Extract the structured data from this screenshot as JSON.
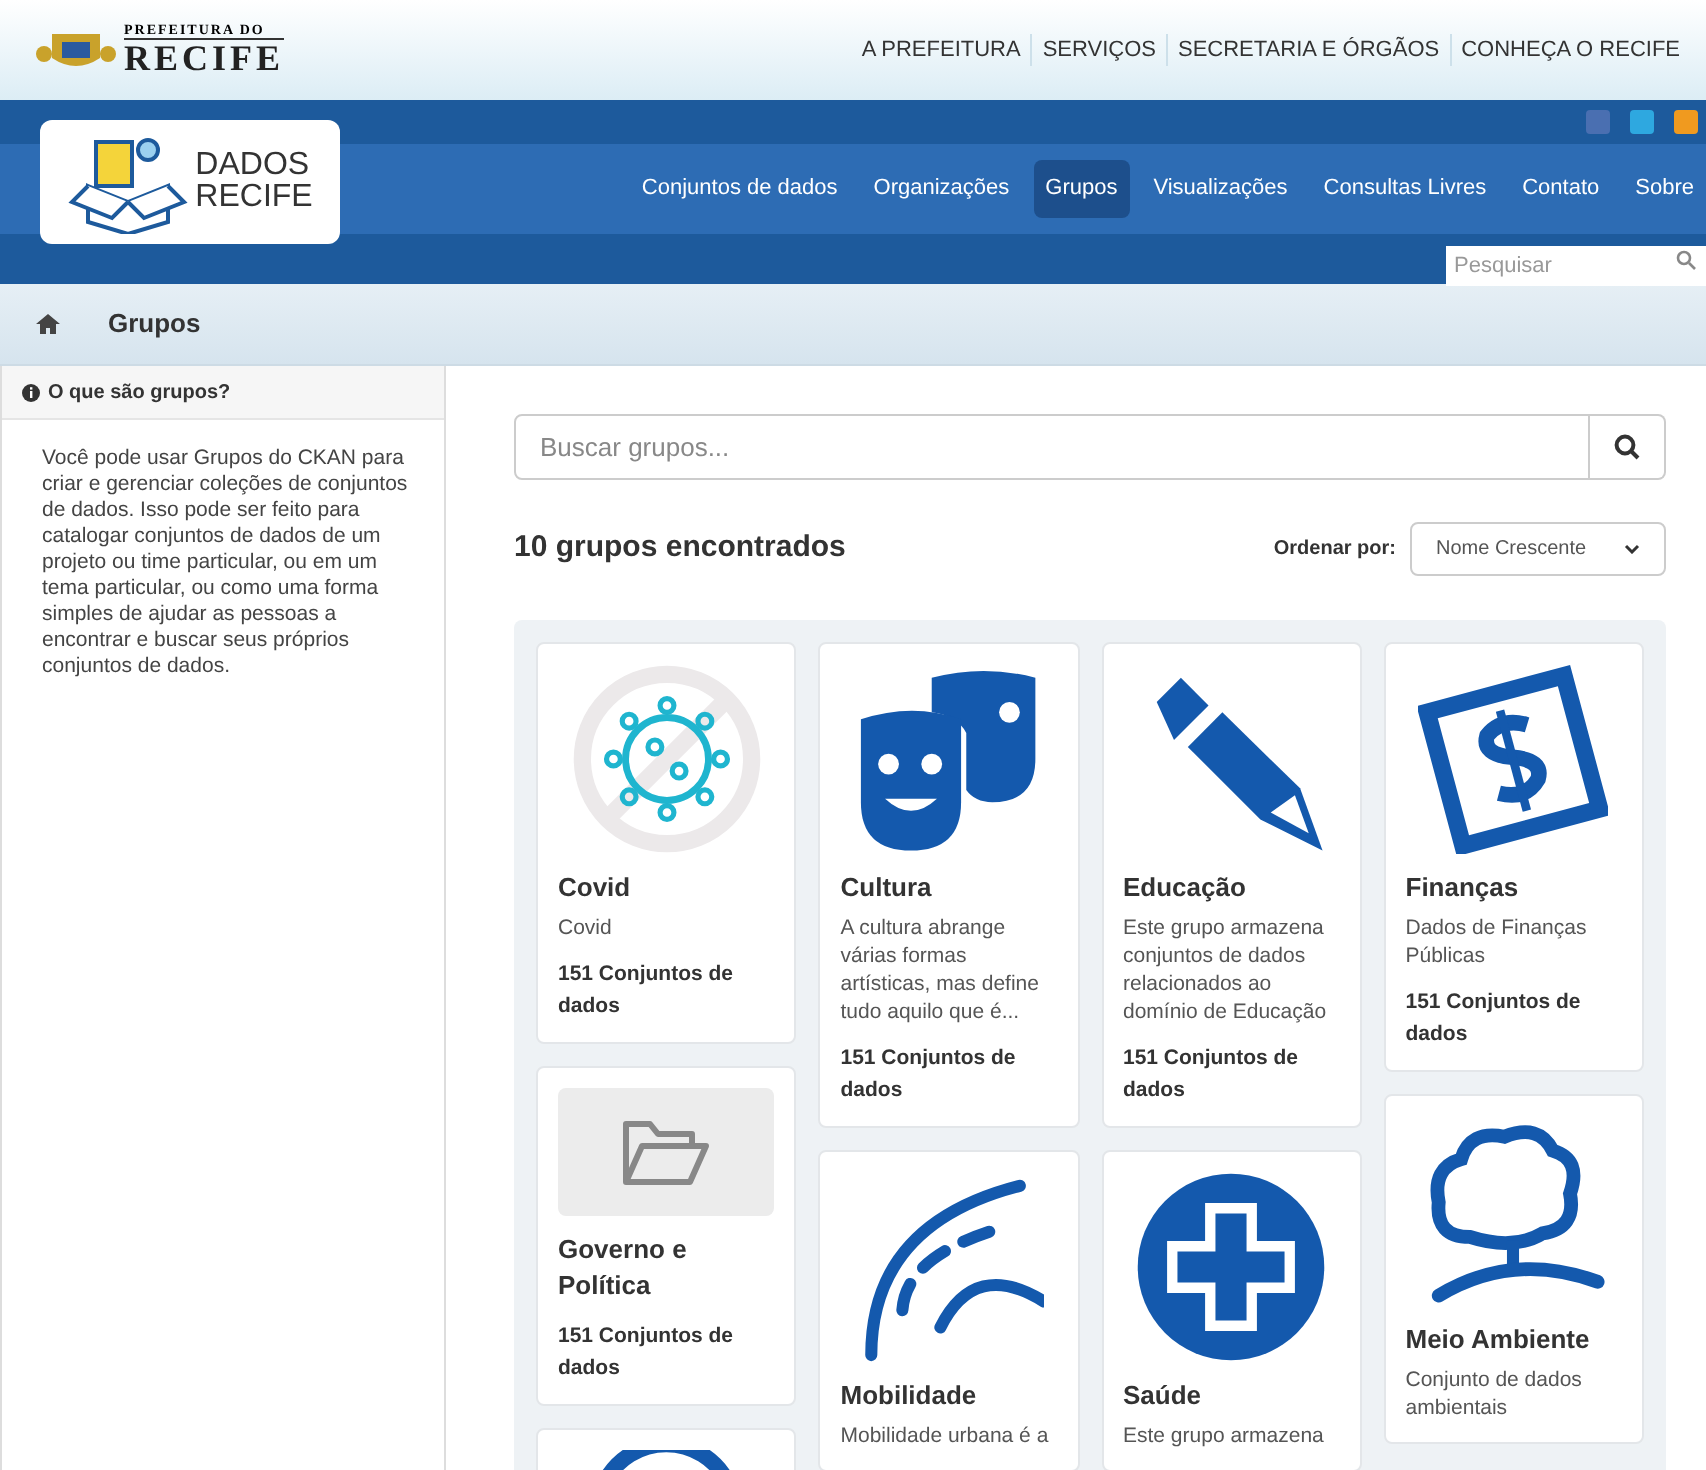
{
  "top_links": [
    "A PREFEITURA",
    "SERVIÇOS",
    "SECRETARIA E ÓRGÃOS",
    "CONHEÇA O RECIFE"
  ],
  "brand": {
    "small": "PREFEITURA DO",
    "large": "RECIFE"
  },
  "logo": {
    "line1": "DADOS",
    "line2": "RECIFE"
  },
  "nav": [
    {
      "label": "Conjuntos de dados",
      "selected": false
    },
    {
      "label": "Organizações",
      "selected": false
    },
    {
      "label": "Grupos",
      "selected": true
    },
    {
      "label": "Visualizações",
      "selected": false
    },
    {
      "label": "Consultas Livres",
      "selected": false
    },
    {
      "label": "Contato",
      "selected": false
    },
    {
      "label": "Sobre",
      "selected": false
    }
  ],
  "site_search": {
    "placeholder": "Pesquisar"
  },
  "breadcrumb": {
    "current": "Grupos"
  },
  "sidebar": {
    "title": "O que são grupos?",
    "text": "Você pode usar Grupos do CKAN para criar e gerenciar coleções de conjuntos de dados. Isso pode ser feito para catalogar conjuntos de dados de um projeto ou time particular, ou em um tema particular, ou como uma forma simples de ajudar as pessoas a encontrar e buscar seus próprios conjuntos de dados."
  },
  "group_search": {
    "placeholder": "Buscar grupos..."
  },
  "results": "10 grupos encontrados",
  "sort": {
    "label": "Ordenar por:",
    "value": "Nome Crescente"
  },
  "group_columns": [
    [
      {
        "kind": "covid",
        "title": "Covid",
        "description": "Covid",
        "count": "151 Conjuntos de dados"
      },
      {
        "kind": "folder",
        "title": "Governo e Política",
        "count": "151 Conjuntos de dados"
      },
      {
        "kind": "ring"
      }
    ],
    [
      {
        "kind": "masks",
        "title": "Cultura",
        "description": "A cultura abrange várias formas artísticas, mas define tudo aquilo que é...",
        "count": "151 Conjuntos de dados"
      },
      {
        "kind": "road",
        "title": "Mobilidade",
        "description": "Mobilidade urbana é a"
      }
    ],
    [
      {
        "kind": "pencil",
        "title": "Educação",
        "description": "Este grupo armazena conjuntos de dados relacionados ao domínio de Educação",
        "count": "151 Conjuntos de dados"
      },
      {
        "kind": "cross",
        "title": "Saúde",
        "description": "Este grupo armazena"
      }
    ],
    [
      {
        "kind": "dollar",
        "title": "Finanças",
        "description": "Dados de Finanças Públicas",
        "count": "151 Conjuntos de dados"
      },
      {
        "kind": "tree",
        "title": "Meio Ambiente",
        "description": "Conjunto de dados ambientais"
      }
    ]
  ]
}
